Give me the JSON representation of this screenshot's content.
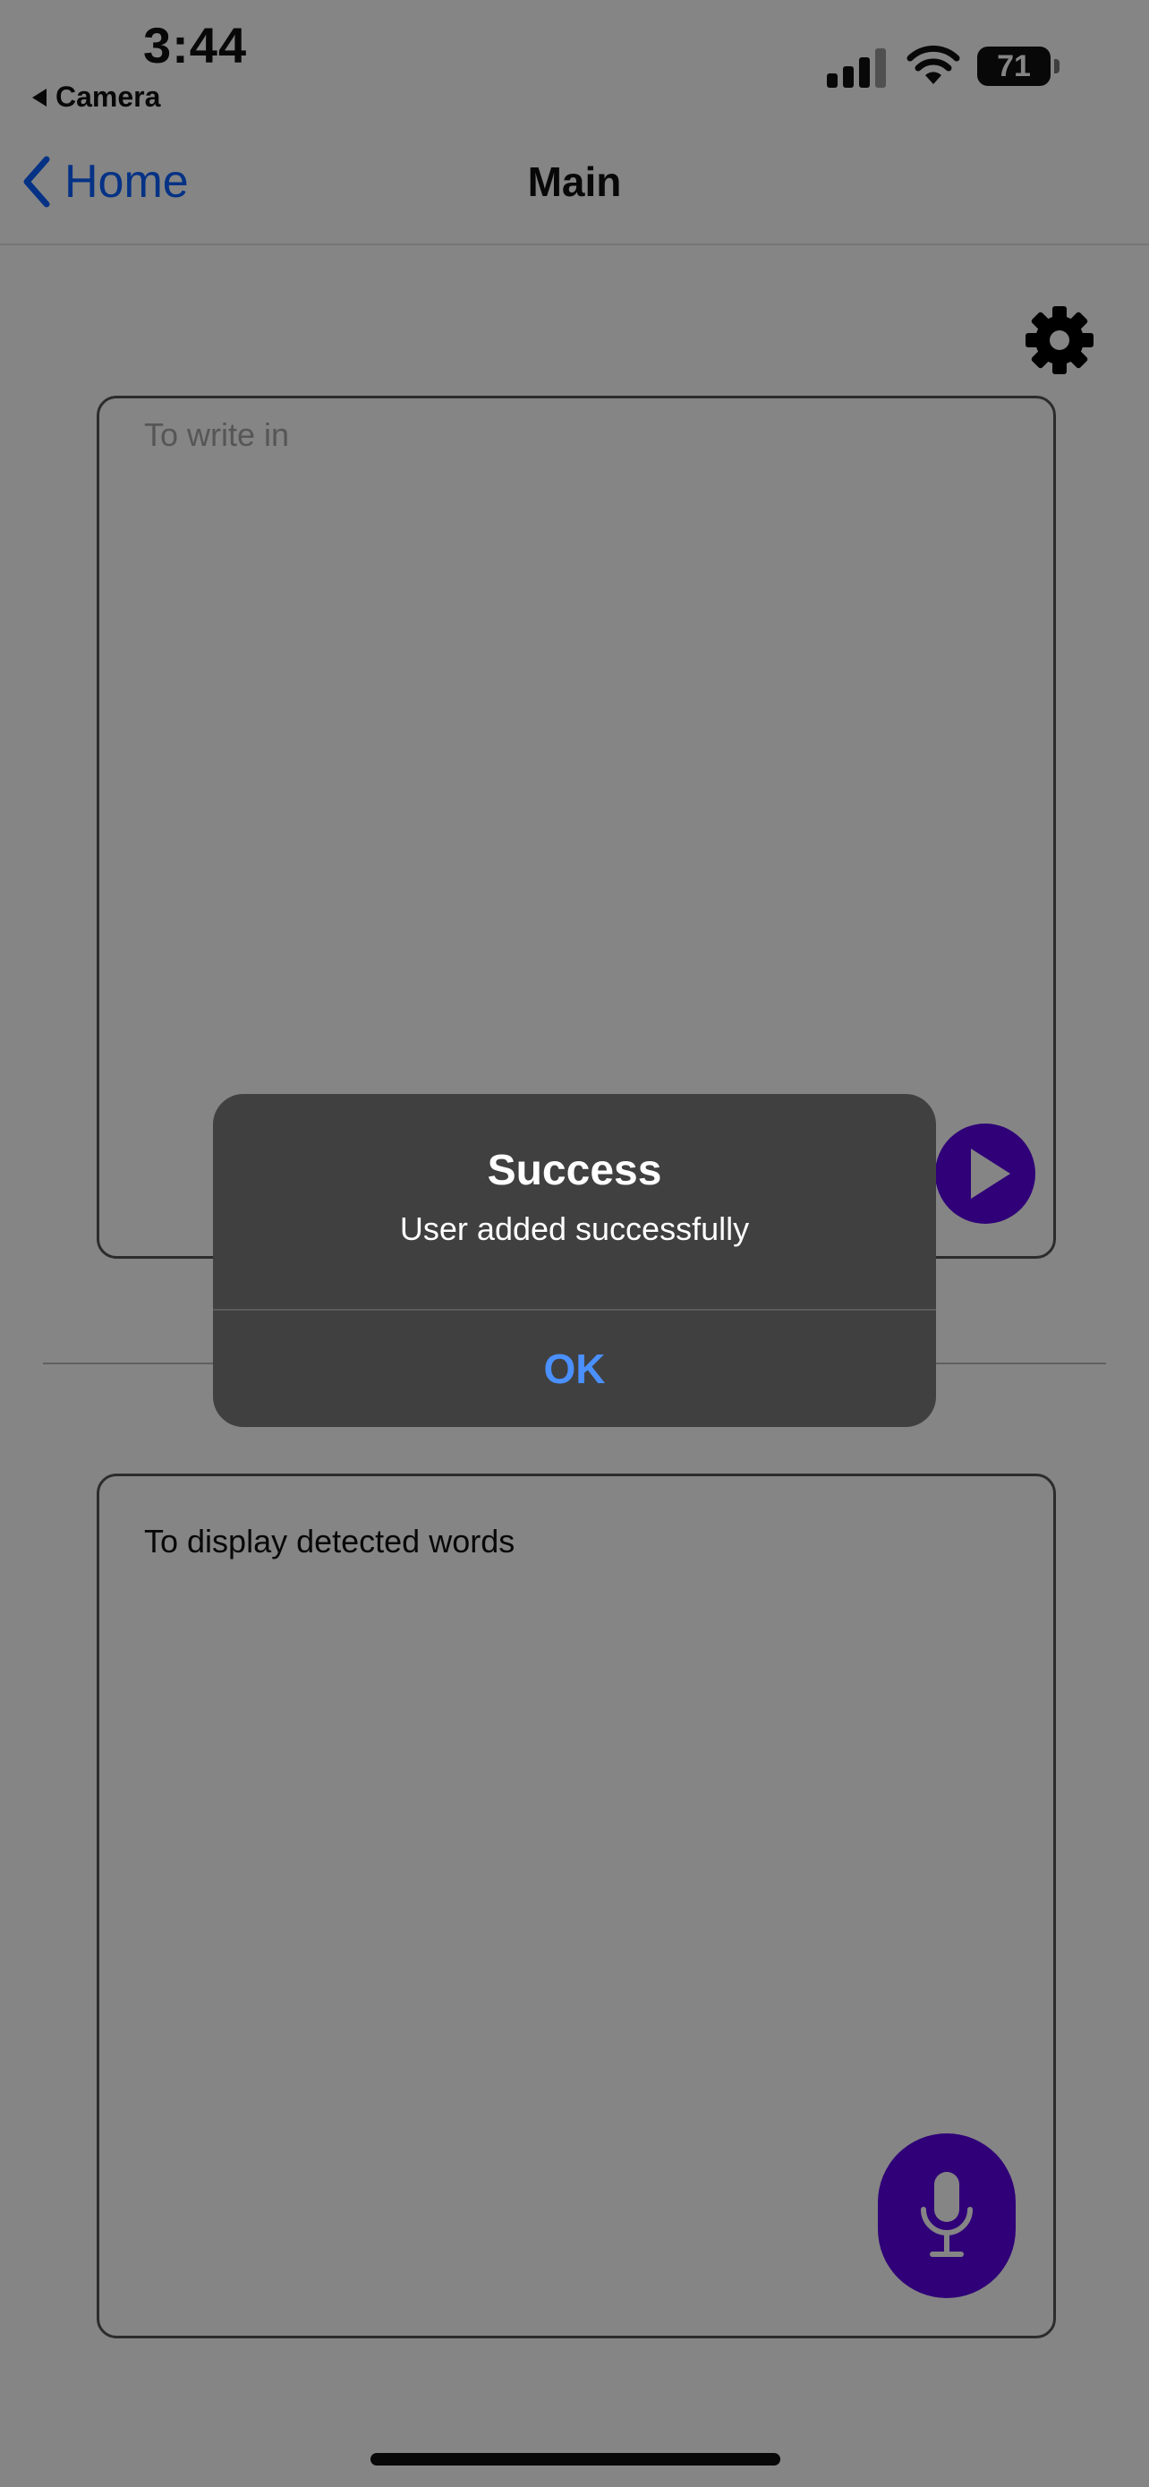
{
  "status_bar": {
    "time": "3:44",
    "back_app": "Camera",
    "battery": "71"
  },
  "nav": {
    "back_label": "Home",
    "title": "Main"
  },
  "input": {
    "placeholder": "To write in"
  },
  "output": {
    "text": "To display detected words"
  },
  "alert": {
    "title": "Success",
    "message": "User added successfully",
    "ok_label": "OK"
  },
  "colors": {
    "accent": "#5a00e6",
    "link": "#0a60ff",
    "alert_button": "#4a90ff"
  },
  "icons": {
    "settings": "gear-icon",
    "play": "play-icon",
    "microphone": "microphone-icon",
    "back": "chevron-left-icon"
  }
}
